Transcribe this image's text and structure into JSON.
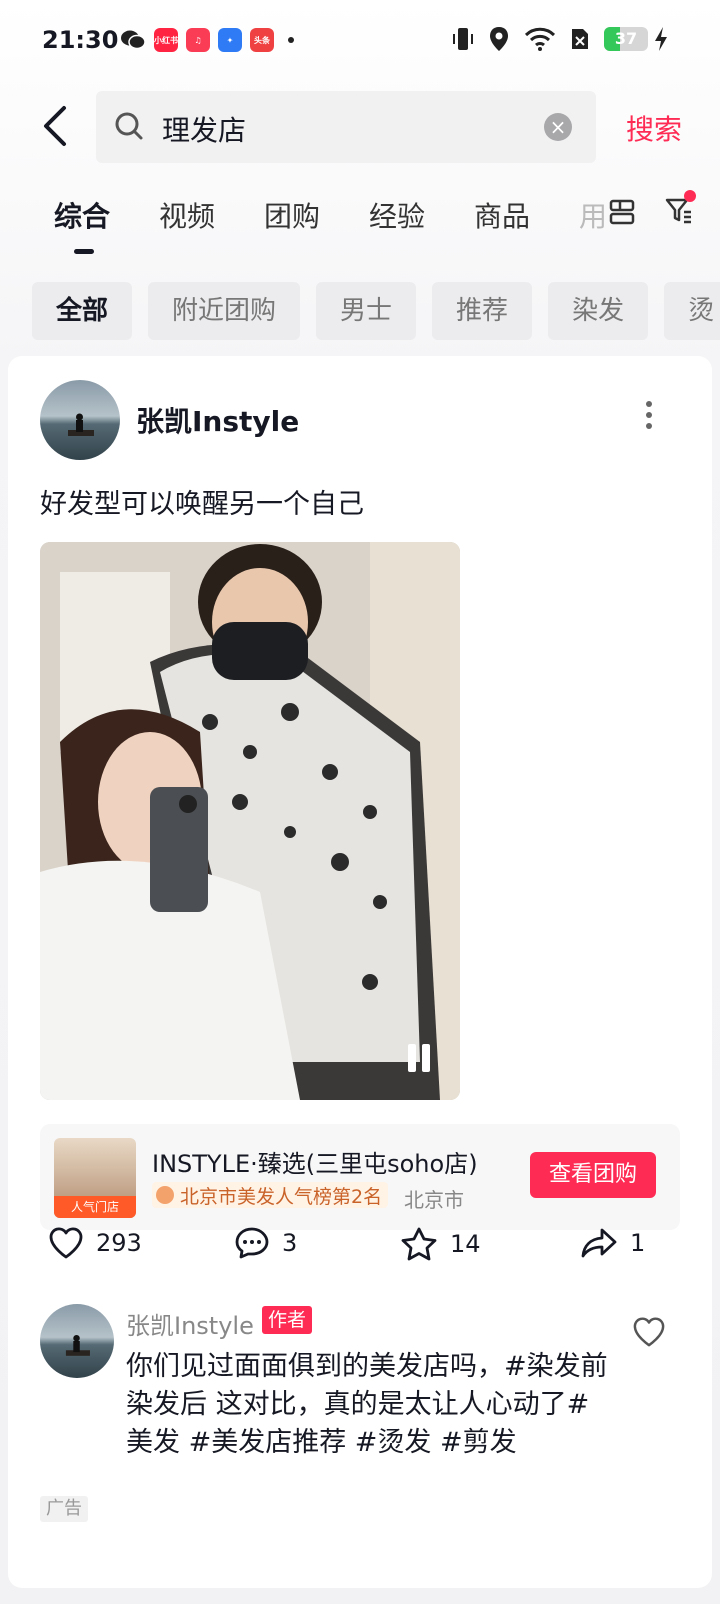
{
  "status_bar": {
    "time": "21:30",
    "battery": "37",
    "battery_level": 0.37,
    "app_badges": [
      "小红书",
      "头条"
    ]
  },
  "search": {
    "query": "理发店",
    "button": "搜索"
  },
  "tabs": [
    {
      "label": "综合",
      "active": true
    },
    {
      "label": "视频"
    },
    {
      "label": "团购"
    },
    {
      "label": "经验"
    },
    {
      "label": "商品"
    },
    {
      "label": "用"
    }
  ],
  "chips": [
    {
      "label": "全部",
      "active": true
    },
    {
      "label": "附近团购"
    },
    {
      "label": "男士"
    },
    {
      "label": "推荐"
    },
    {
      "label": "染发"
    },
    {
      "label": "烫"
    }
  ],
  "post": {
    "author": "张凯Instyle",
    "caption": "好发型可以唤醒另一个自己",
    "store": {
      "name": "INSTYLE·臻选(三里屯soho店)",
      "thumb_tag": "人气门店",
      "rank": "北京市美发人气榜第2名",
      "city": "北京市",
      "button": "查看团购"
    },
    "actions": {
      "likes": "293",
      "comments": "3",
      "favorites": "14",
      "shares": "1"
    },
    "comment": {
      "author": "张凯Instyle",
      "badge": "作者",
      "text": "你们见过面面俱到的美发店吗，#染发前染发后 这对比，真的是太让人心动了#美发 #美发店推荐 #烫发 #剪发"
    },
    "ad_label": "广告"
  },
  "colors": {
    "accent": "#fe2c55",
    "text": "#161823"
  }
}
